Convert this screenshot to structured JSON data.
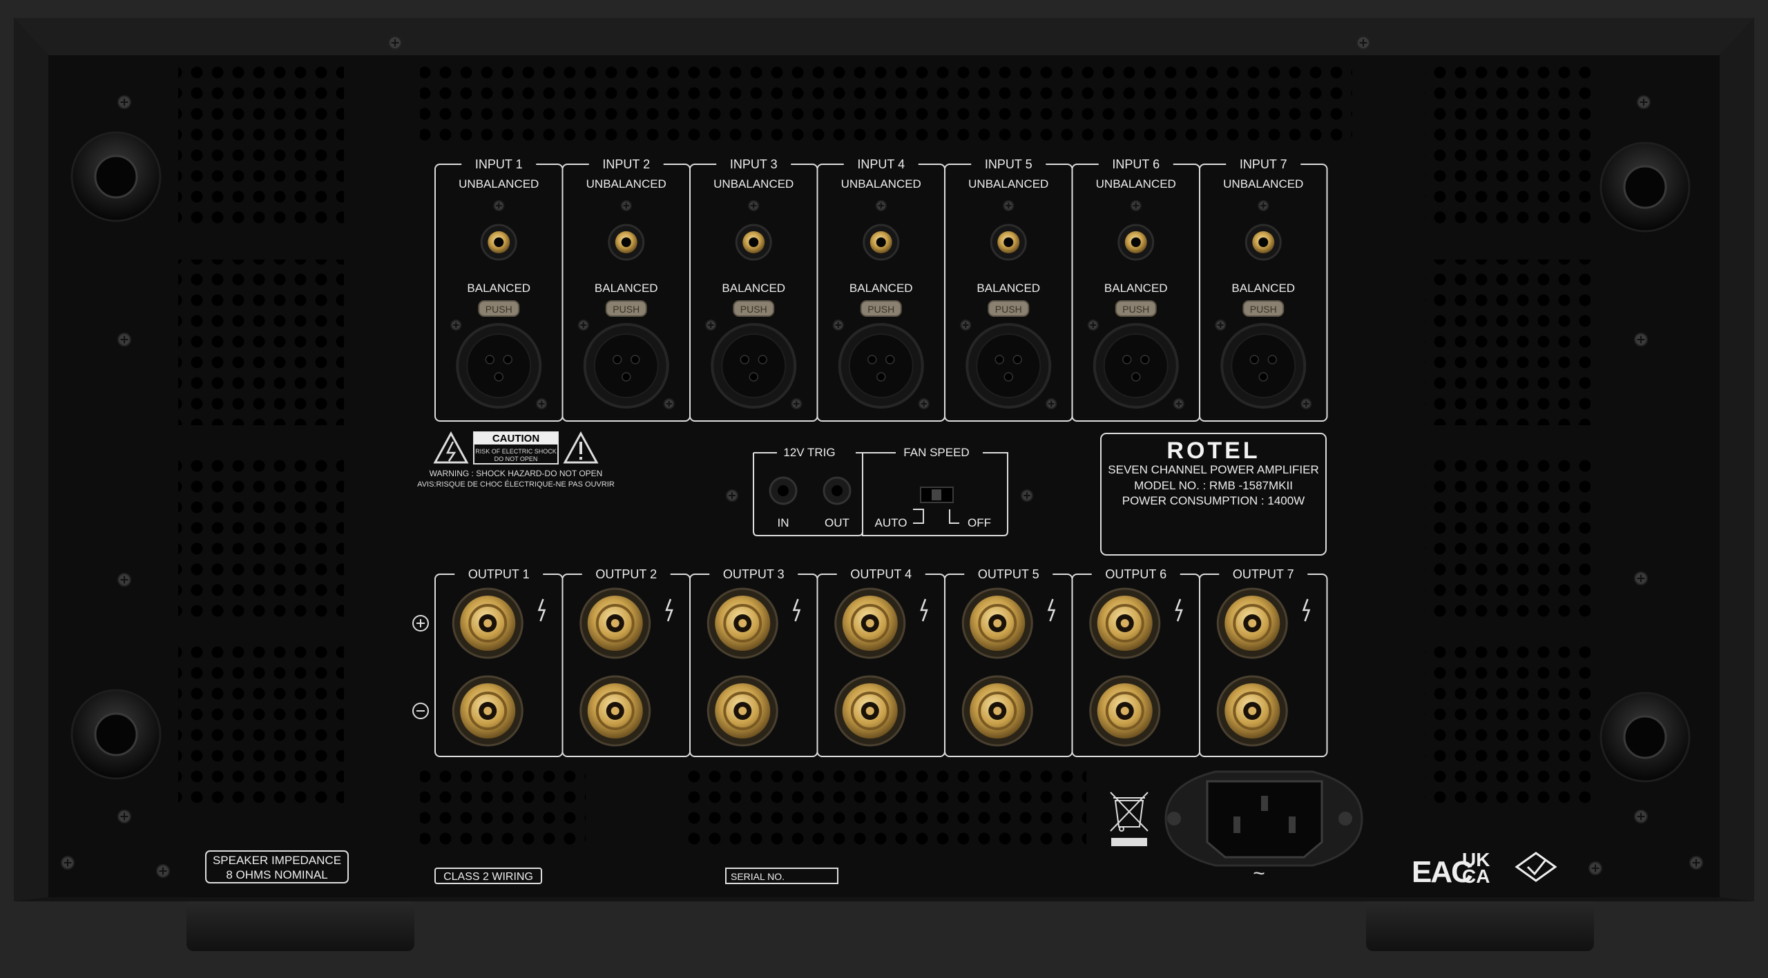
{
  "colors": {
    "background": "#262626",
    "chassis": "#121212",
    "panel": "#0b0b0b",
    "label": "#e8e8e8",
    "gold": "#c9a04a"
  },
  "inputs": [
    {
      "title": "INPUT 1",
      "unbalanced": "UNBALANCED",
      "balanced": "BALANCED",
      "push": "PUSH"
    },
    {
      "title": "INPUT 2",
      "unbalanced": "UNBALANCED",
      "balanced": "BALANCED",
      "push": "PUSH"
    },
    {
      "title": "INPUT 3",
      "unbalanced": "UNBALANCED",
      "balanced": "BALANCED",
      "push": "PUSH"
    },
    {
      "title": "INPUT 4",
      "unbalanced": "UNBALANCED",
      "balanced": "BALANCED",
      "push": "PUSH"
    },
    {
      "title": "INPUT 5",
      "unbalanced": "UNBALANCED",
      "balanced": "BALANCED",
      "push": "PUSH"
    },
    {
      "title": "INPUT 6",
      "unbalanced": "UNBALANCED",
      "balanced": "BALANCED",
      "push": "PUSH"
    },
    {
      "title": "INPUT 7",
      "unbalanced": "UNBALANCED",
      "balanced": "BALANCED",
      "push": "PUSH"
    }
  ],
  "outputs": [
    "OUTPUT 1",
    "OUTPUT 2",
    "OUTPUT 3",
    "OUTPUT 4",
    "OUTPUT 5",
    "OUTPUT 6",
    "OUTPUT 7"
  ],
  "polarity": {
    "plus": "+",
    "minus": "−"
  },
  "caution": {
    "title": "CAUTION",
    "line1": "RISK OF ELECTRIC SHOCK",
    "line2": "DO NOT OPEN",
    "warning_en": "WARNING : SHOCK HAZARD-DO NOT OPEN",
    "warning_fr": "AVIS:RISQUE DE CHOC ÉLECTRIQUE-NE PAS OUVRIR"
  },
  "trigger": {
    "title": "12V TRIG",
    "in": "IN",
    "out": "OUT"
  },
  "fan": {
    "title": "FAN SPEED",
    "auto": "AUTO",
    "off": "OFF"
  },
  "brand": {
    "logo": "ROTEL",
    "product": "SEVEN CHANNEL POWER AMPLIFIER",
    "model": "MODEL NO. : RMB -1587MKII",
    "power": "POWER CONSUMPTION : 1400W"
  },
  "impedance": {
    "line1": "SPEAKER IMPEDANCE",
    "line2": "8 OHMS NOMINAL"
  },
  "class2": "CLASS 2 WIRING",
  "serial": "SERIAL NO.",
  "ac_symbol": "~",
  "certifications": {
    "eac": "EAC",
    "ukca_top": "UK",
    "ukca_bottom": "CA"
  },
  "icons": [
    "screw-icon",
    "rca-jack-icon",
    "xlr-jack-icon",
    "binding-post-icon",
    "warning-triangle-icon",
    "weee-bin-icon",
    "power-inlet-icon",
    "rcm-mark-icon",
    "speaker-hot-icon"
  ]
}
